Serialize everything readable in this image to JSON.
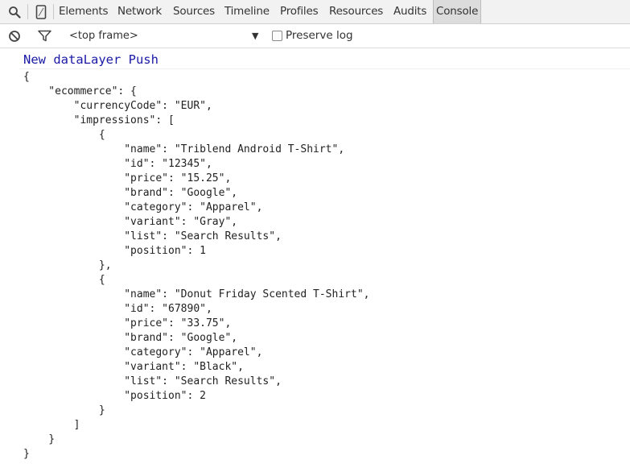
{
  "tabbar": {
    "search_icon": "search-icon",
    "device_icon": "mobile-device-icon",
    "tabs": [
      {
        "label": "Elements",
        "active": false
      },
      {
        "label": "Network",
        "active": false
      },
      {
        "label": "Sources",
        "active": false
      },
      {
        "label": "Timeline",
        "active": false
      },
      {
        "label": "Profiles",
        "active": false
      },
      {
        "label": "Resources",
        "active": false
      },
      {
        "label": "Audits",
        "active": false
      },
      {
        "label": "Console",
        "active": true
      }
    ]
  },
  "toolbar": {
    "clear_icon": "clear-console-icon",
    "filter_icon": "filter-icon",
    "frame_select": "<top frame>",
    "dropdown_icon": "dropdown-arrow-icon",
    "preserve_log_label": "Preserve log",
    "preserve_log_checked": false
  },
  "console": {
    "title": "New dataLayer Push",
    "title_color": "#1a1aa6",
    "lines": [
      "{",
      "    \"ecommerce\": {",
      "        \"currencyCode\": \"EUR\",",
      "        \"impressions\": [",
      "            {",
      "                \"name\": \"Triblend Android T-Shirt\",",
      "                \"id\": \"12345\",",
      "                \"price\": \"15.25\",",
      "                \"brand\": \"Google\",",
      "                \"category\": \"Apparel\",",
      "                \"variant\": \"Gray\",",
      "                \"list\": \"Search Results\",",
      "                \"position\": 1",
      "            },",
      "            {",
      "                \"name\": \"Donut Friday Scented T-Shirt\",",
      "                \"id\": \"67890\",",
      "                \"price\": \"33.75\",",
      "                \"brand\": \"Google\",",
      "                \"category\": \"Apparel\",",
      "                \"variant\": \"Black\",",
      "                \"list\": \"Search Results\",",
      "                \"position\": 2",
      "            }",
      "        ]",
      "    }",
      "}"
    ]
  }
}
